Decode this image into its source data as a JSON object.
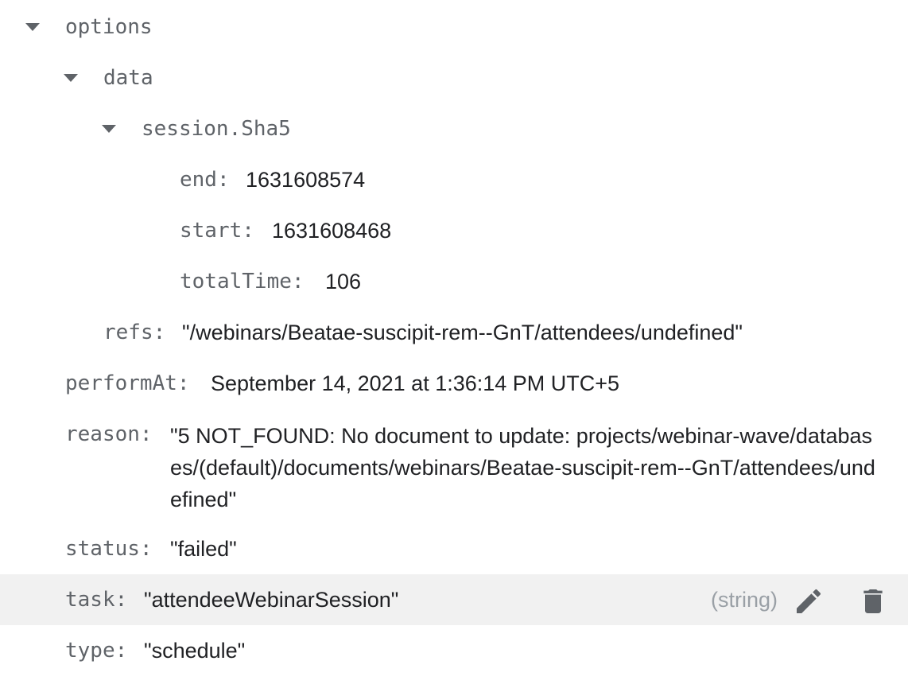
{
  "tree": {
    "options": {
      "key": "options",
      "data": {
        "key": "data",
        "session": {
          "key": "session.Sha5",
          "end": {
            "key": "end",
            "value": "1631608574"
          },
          "start": {
            "key": "start",
            "value": "1631608468"
          },
          "totalTime": {
            "key": "totalTime",
            "value": "106"
          }
        }
      },
      "refs": {
        "key": "refs",
        "value": "\"/webinars/Beatae-suscipit-rem--GnT/attendees/undefined\""
      }
    },
    "performAt": {
      "key": "performAt",
      "value": "September 14, 2021 at 1:36:14 PM UTC+5"
    },
    "reason": {
      "key": "reason",
      "value": "\"5 NOT_FOUND: No document to update: projects/webinar-wave/databases/(default)/documents/webinars/Beatae-suscipit-rem--GnT/attendees/undefined\""
    },
    "status": {
      "key": "status",
      "value": "\"failed\""
    },
    "task": {
      "key": "task",
      "value": "\"attendeeWebinarSession\"",
      "type_hint": "(string)"
    },
    "type": {
      "key": "type",
      "value": "\"schedule\""
    }
  },
  "icons": {
    "expand": "triangle-down-icon",
    "edit": "pencil-icon",
    "delete": "trash-icon"
  },
  "colors": {
    "key": "#5f6368",
    "value": "#202124",
    "hint": "#9aa0a6",
    "hover_row": "#f1f1f1",
    "icon": "#5f6368"
  }
}
